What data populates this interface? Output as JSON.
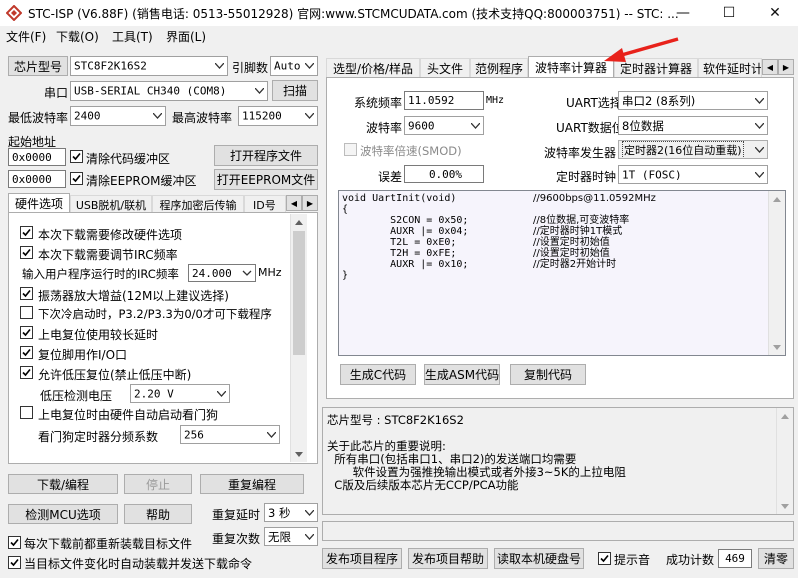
{
  "window": {
    "title": "STC-ISP (V6.88F) (销售电话: 0513-55012928) 官网:www.STCMCUDATA.com  (技术支持QQ:800003751) -- STC: ...",
    "min_symbol": "—",
    "max_symbol": "☐",
    "close_symbol": "✕",
    "icon": "stc-isp-logo-icon"
  },
  "menu": [
    "文件(F)",
    "下载(O)",
    "工具(T)",
    "界面(L)"
  ],
  "left": {
    "chip_label": "芯片型号",
    "chip_value": "STC8F2K16S2",
    "pin_label": "引脚数",
    "pin_value": "Auto",
    "port_label": "串口",
    "port_value": "USB-SERIAL CH340 (COM8)",
    "scan_button": "扫描",
    "min_baud_label": "最低波特率",
    "min_baud_value": "2400",
    "max_baud_label": "最高波特率",
    "max_baud_value": "115200",
    "start_addr_label": "起始地址",
    "addr1_value": "0x0000",
    "addr1_check": "清除代码缓冲区",
    "open_prog_button": "打开程序文件",
    "addr2_value": "0x0000",
    "addr2_check": "清除EEPROM缓冲区",
    "open_eeprom_button": "打开EEPROM文件",
    "tabs": [
      "硬件选项",
      "USB脱机/联机",
      "程序加密后传输",
      "ID号"
    ],
    "options": [
      {
        "label": "本次下载需要修改硬件选项",
        "checked": true
      },
      {
        "label": "本次下载需要调节IRC频率",
        "checked": true
      }
    ],
    "irc_label": "输入用户程序运行时的IRC频率",
    "irc_value": "24.000",
    "irc_unit": "MHz",
    "options2": [
      {
        "label": "振荡器放大增益(12M以上建议选择)",
        "checked": true
      },
      {
        "label": "下次冷启动时，P3.2/P3.3为0/0才可下载程序",
        "checked": false
      },
      {
        "label": "上电复位使用较长延时",
        "checked": true
      },
      {
        "label": "复位脚用作I/O口",
        "checked": true
      },
      {
        "label": "允许低压复位(禁止低压中断)",
        "checked": true
      }
    ],
    "lvd_label": "低压检测电压",
    "lvd_value": "2.20 V",
    "wdt_check": {
      "label": "上电复位时由硬件自动启动看门狗",
      "checked": false
    },
    "wdt_div_label": "看门狗定时器分频系数",
    "wdt_div_value": "256",
    "download_button": "下载/编程",
    "stop_button": "停止",
    "reprogram_button": "重复编程",
    "check_mcu_button": "检测MCU选项",
    "help_button": "帮助",
    "repeat_delay_label": "重复延时",
    "repeat_delay_value": "3 秒",
    "repeat_count_label": "重复次数",
    "repeat_count_value": "无限",
    "reload_check": {
      "label": "每次下载前都重新装载目标文件",
      "checked": true
    },
    "auto_send_check": {
      "label": "当目标文件变化时自动装载并发送下载命令",
      "checked": true
    }
  },
  "right": {
    "tabs": [
      "选型/价格/样品",
      "头文件",
      "范例程序",
      "波特率计算器",
      "定时器计算器",
      "软件延时计"
    ],
    "active_tab": 3,
    "freq_label": "系统频率",
    "freq_value": "11.0592",
    "freq_unit": "MHz",
    "uart_sel_label": "UART选择",
    "uart_sel_value": "串口2 (8系列)",
    "baud_label": "波特率",
    "baud_value": "9600",
    "uart_bits_label": "UART数据位",
    "uart_bits_value": "8位数据",
    "smod_label": "波特率倍速(SMOD)",
    "baudgen_label": "波特率发生器",
    "baudgen_value": "定时器2(16位自动重载)",
    "error_label": "误差",
    "error_value": "0.00%",
    "timer_clk_label": "定时器时钟",
    "timer_clk_value": "1T  (FOSC)",
    "code": [
      {
        "code": "void UartInit(void)",
        "comment": "//9600bps@11.0592MHz"
      },
      {
        "code": "{",
        "comment": ""
      },
      {
        "code": "        S2CON = 0x50;",
        "comment": "//8位数据,可变波特率"
      },
      {
        "code": "        AUXR |= 0x04;",
        "comment": "//定时器时钟1T模式"
      },
      {
        "code": "        T2L = 0xE0;",
        "comment": "//设置定时初始值"
      },
      {
        "code": "        T2H = 0xFE;",
        "comment": "//设置定时初始值"
      },
      {
        "code": "        AUXR |= 0x10;",
        "comment": "//定时器2开始计时"
      },
      {
        "code": "}",
        "comment": ""
      }
    ],
    "gen_c_button": "生成C代码",
    "gen_asm_button": "生成ASM代码",
    "copy_button": "复制代码",
    "info_lines": [
      "芯片型号 : STC8F2K16S2",
      "",
      "关于此芯片的重要说明:",
      "  所有串口(包括串口1、串口2)的发送端口均需要",
      "       软件设置为强推挽输出模式或者外接3~5K的上拉电阻",
      "  C版及后续版本芯片无CCP/PCA功能"
    ],
    "publish_prog_button": "发布项目程序",
    "publish_help_button": "发布项目帮助",
    "read_id_button": "读取本机硬盘号",
    "beep_check": {
      "label": "提示音",
      "checked": true
    },
    "count_label": "成功计数",
    "count_value": "469",
    "clear_button": "清零"
  },
  "colors": {
    "arrow_red": "#e8221b",
    "code_bg": "#f6f4fc",
    "tab_border": "#adadad"
  }
}
